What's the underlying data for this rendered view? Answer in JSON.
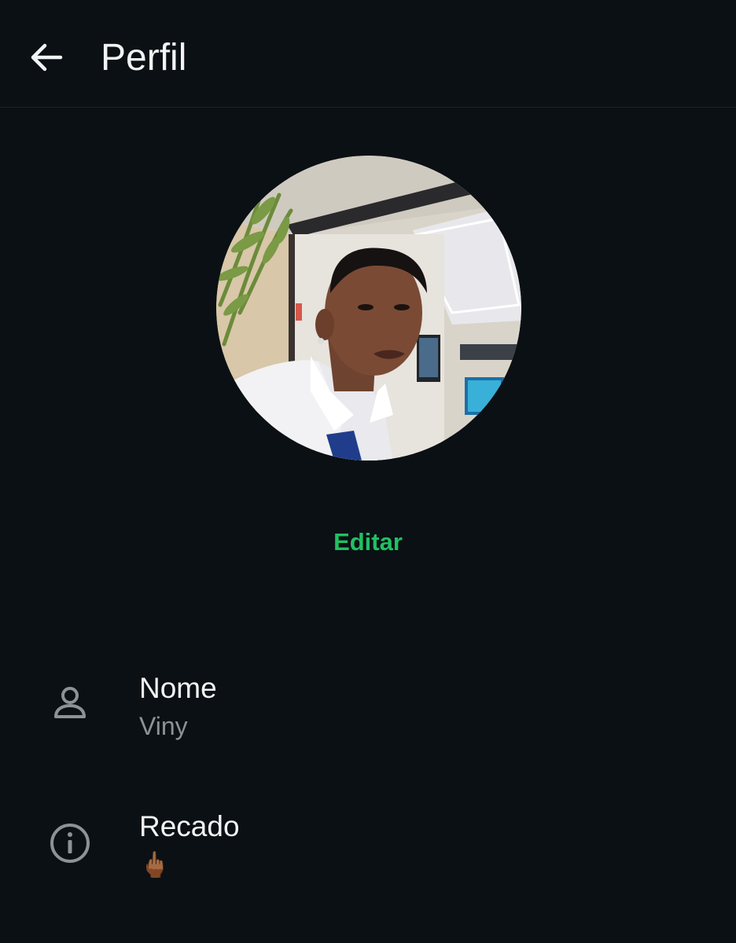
{
  "header": {
    "back_icon": "arrow-left-icon",
    "title": "Perfil"
  },
  "profile": {
    "photo_alt": "Foto do perfil",
    "edit_label": "Editar"
  },
  "fields": [
    {
      "icon": "person-icon",
      "title": "Nome",
      "value": "Viny"
    },
    {
      "icon": "info-icon",
      "title": "Recado",
      "value": "🖕🏾"
    }
  ],
  "colors": {
    "background": "#0b1014",
    "accent": "#21c063",
    "primary_text": "#f1f3f4",
    "secondary_text": "#8b9397",
    "icon": "#8b9397"
  }
}
